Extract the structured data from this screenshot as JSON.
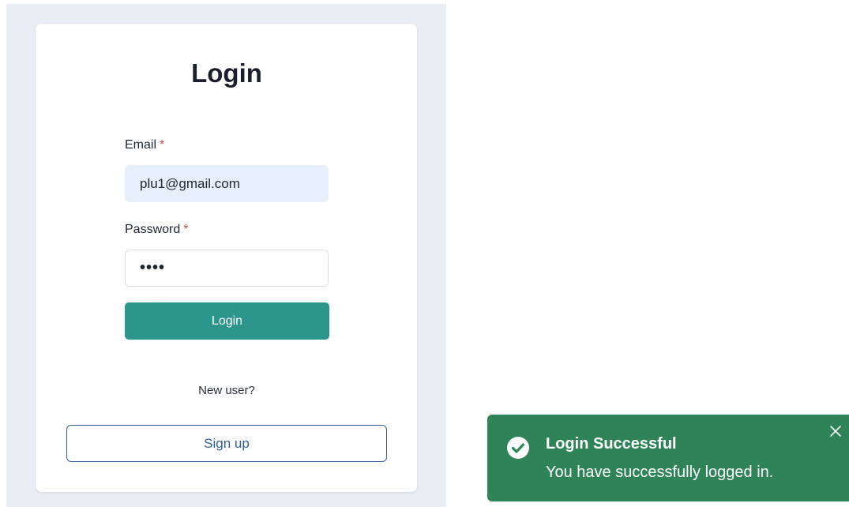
{
  "login_card": {
    "title": "Login",
    "email_label": "Email",
    "email_required_marker": "*",
    "email_value": "plu1@gmail.com",
    "password_label": "Password",
    "password_required_marker": "*",
    "password_masked_value": "••••",
    "login_button_label": "Login",
    "new_user_text": "New user?",
    "signup_button_label": "Sign up"
  },
  "toast": {
    "title": "Login Successful",
    "message": "You have successfully logged in.",
    "icon": "check-circle-icon",
    "close_icon": "close-icon",
    "background_color": "#2e8457"
  },
  "colors": {
    "primary_button": "#2d968c",
    "signup_border": "#33609a",
    "required_marker": "#e0453b",
    "page_background": "#e9eef5"
  }
}
